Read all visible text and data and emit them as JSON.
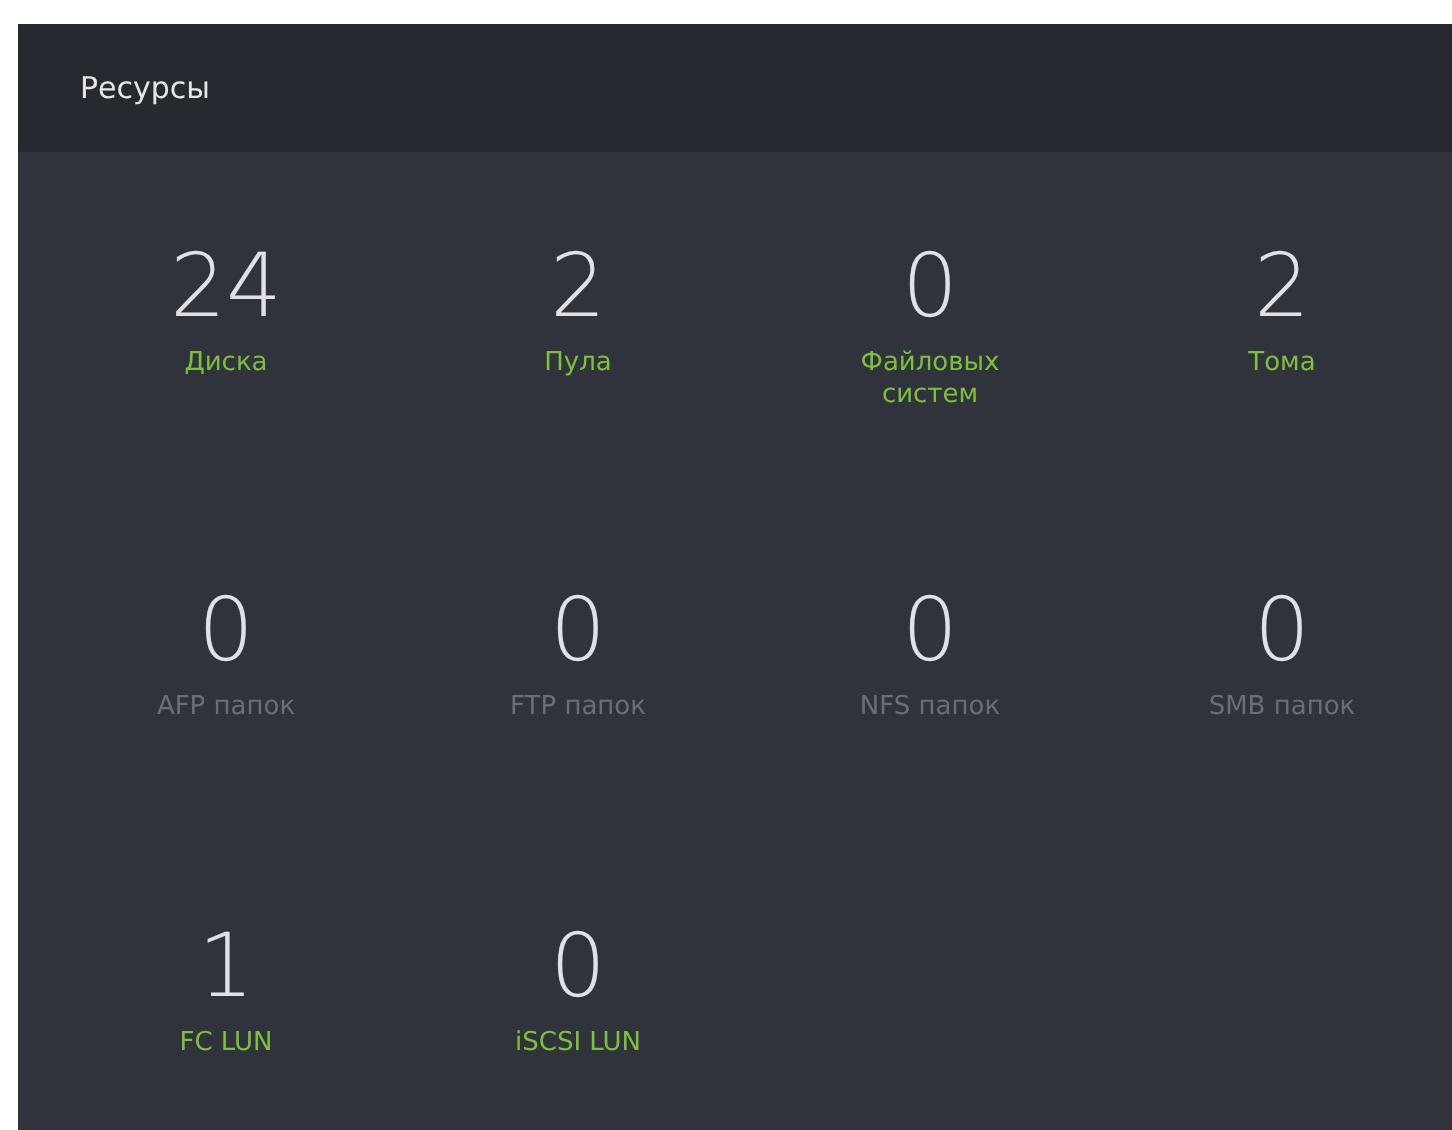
{
  "panel": {
    "title": "Ресурсы"
  },
  "stats": [
    {
      "value": "24",
      "label": "Диска",
      "color": "#7dc13a"
    },
    {
      "value": "2",
      "label": "Пула",
      "color": "#7dc13a"
    },
    {
      "value": "0",
      "label": "Файловых систем",
      "color": "#7dc13a"
    },
    {
      "value": "2",
      "label": "Тома",
      "color": "#7dc13a"
    },
    {
      "value": "0",
      "label": "AFP папок",
      "color": "#6b6e75"
    },
    {
      "value": "0",
      "label": "FTP папок",
      "color": "#6b6e75"
    },
    {
      "value": "0",
      "label": "NFS папок",
      "color": "#6b6e75"
    },
    {
      "value": "0",
      "label": "SMB папок",
      "color": "#6b6e75"
    },
    {
      "value": "1",
      "label": "FC LUN",
      "color": "#7dc13a"
    },
    {
      "value": "0",
      "label": "iSCSI LUN",
      "color": "#7dc13a"
    }
  ]
}
